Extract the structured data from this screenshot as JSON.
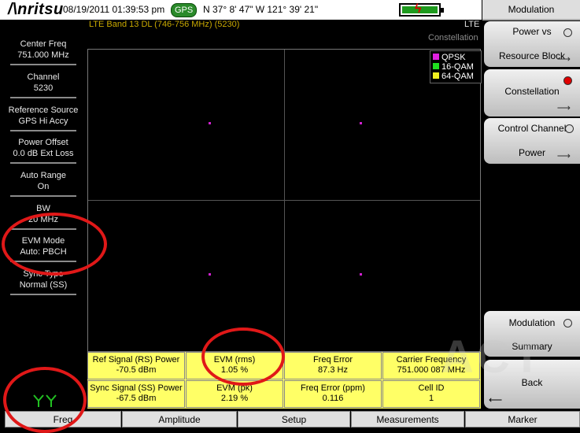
{
  "status": {
    "brand": "/\\nritsu",
    "datetime": "08/19/2011 01:39:53 pm",
    "gps_badge": "GPS",
    "coords": "N 37° 8' 47\" W 121° 39' 21\""
  },
  "header": {
    "band": "LTE Band 13 DL (746-756 MHz) (5230)",
    "mode": "LTE",
    "view": "Constellation"
  },
  "left_panel": [
    {
      "label": "Center Freq",
      "value": "751.000 MHz"
    },
    {
      "label": "Channel",
      "value": "5230"
    },
    {
      "label": "Reference Source",
      "value": "GPS Hi Accy"
    },
    {
      "label": "Power Offset",
      "value": "0.0 dB Ext Loss"
    },
    {
      "label": "Auto Range",
      "value": "On"
    },
    {
      "label": "BW",
      "value": "20 MHz"
    },
    {
      "label": "EVM Mode",
      "value": "Auto: PBCH"
    },
    {
      "label": "Sync Type",
      "value": "Normal (SS)"
    }
  ],
  "legend": [
    {
      "name": "QPSK",
      "color": "#e020e0"
    },
    {
      "name": "16-QAM",
      "color": "#20e020"
    },
    {
      "name": "64-QAM",
      "color": "#f0f020"
    }
  ],
  "results": [
    {
      "label": "Ref Signal (RS) Power",
      "value": "-70.5 dBm"
    },
    {
      "label": "EVM (rms)",
      "value": "1.05 %"
    },
    {
      "label": "Freq Error",
      "value": "87.3 Hz"
    },
    {
      "label": "Carrier Frequency",
      "value": "751.000 087 MHz"
    },
    {
      "label": "Sync Signal (SS) Power",
      "value": "-67.5 dBm"
    },
    {
      "label": "EVM (pk)",
      "value": "2.19 %"
    },
    {
      "label": "Freq Error (ppm)",
      "value": "0.116"
    },
    {
      "label": "Cell ID",
      "value": "1"
    }
  ],
  "right_panel": {
    "title": "Modulation",
    "keys": [
      {
        "line1": "Power vs",
        "line2": "Resource Block"
      },
      {
        "line1": "Constellation",
        "line2": ""
      },
      {
        "line1": "Control Channel",
        "line2": "Power"
      },
      {
        "line1": "Modulation",
        "line2": "Summary"
      },
      {
        "line1": "Back",
        "line2": ""
      }
    ]
  },
  "tabs": [
    "Freq",
    "Amplitude",
    "Setup",
    "Measurements",
    "Marker"
  ],
  "watermark": "ACT"
}
